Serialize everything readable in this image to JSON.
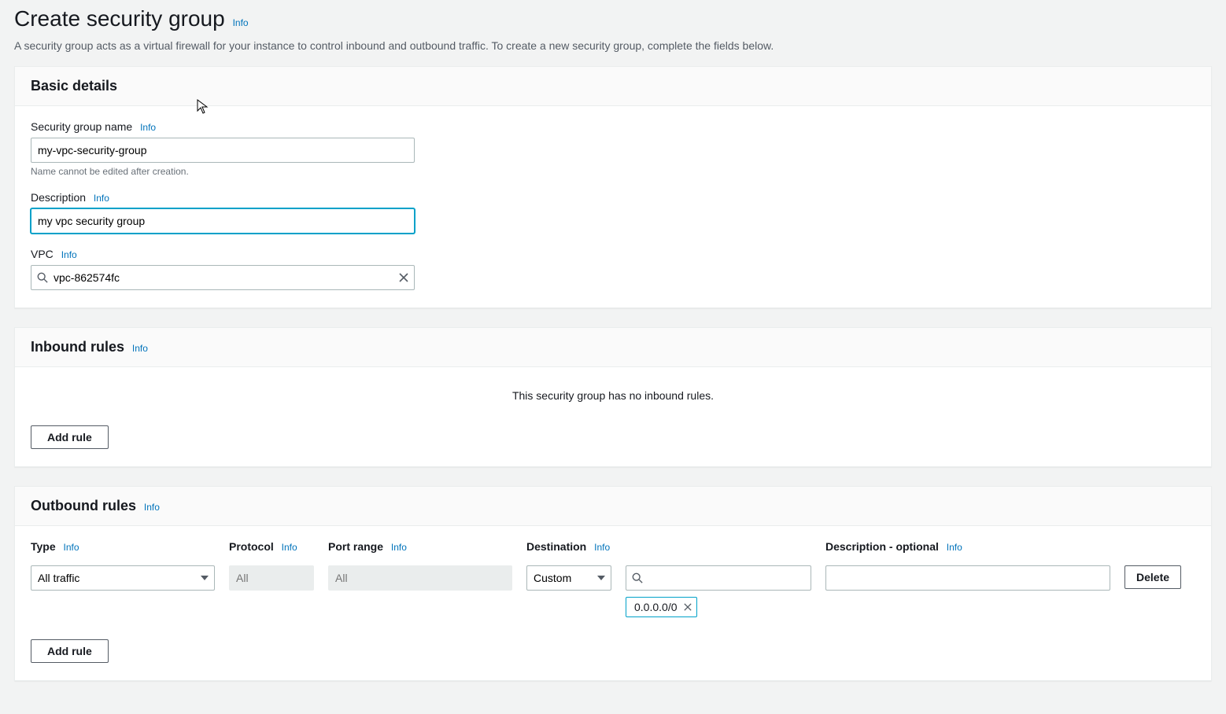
{
  "page": {
    "title": "Create security group",
    "info": "Info",
    "subtitle": "A security group acts as a virtual firewall for your instance to control inbound and outbound traffic. To create a new security group, complete the fields below."
  },
  "basic": {
    "heading": "Basic details",
    "name_label": "Security group name",
    "name_value": "my-vpc-security-group",
    "name_hint": "Name cannot be edited after creation.",
    "desc_label": "Description",
    "desc_value": "my vpc security group",
    "vpc_label": "VPC",
    "vpc_value": "vpc-862574fc"
  },
  "inbound": {
    "heading": "Inbound rules",
    "empty_msg": "This security group has no inbound rules.",
    "add_rule": "Add rule"
  },
  "outbound": {
    "heading": "Outbound rules",
    "add_rule": "Add rule",
    "headers": {
      "type": "Type",
      "protocol": "Protocol",
      "port_range": "Port range",
      "destination": "Destination",
      "description": "Description - optional"
    },
    "row": {
      "type": "All traffic",
      "protocol_placeholder": "All",
      "port_placeholder": "All",
      "destination_mode": "Custom",
      "destination_chip": "0.0.0.0/0",
      "delete": "Delete"
    }
  },
  "common": {
    "info": "Info"
  }
}
